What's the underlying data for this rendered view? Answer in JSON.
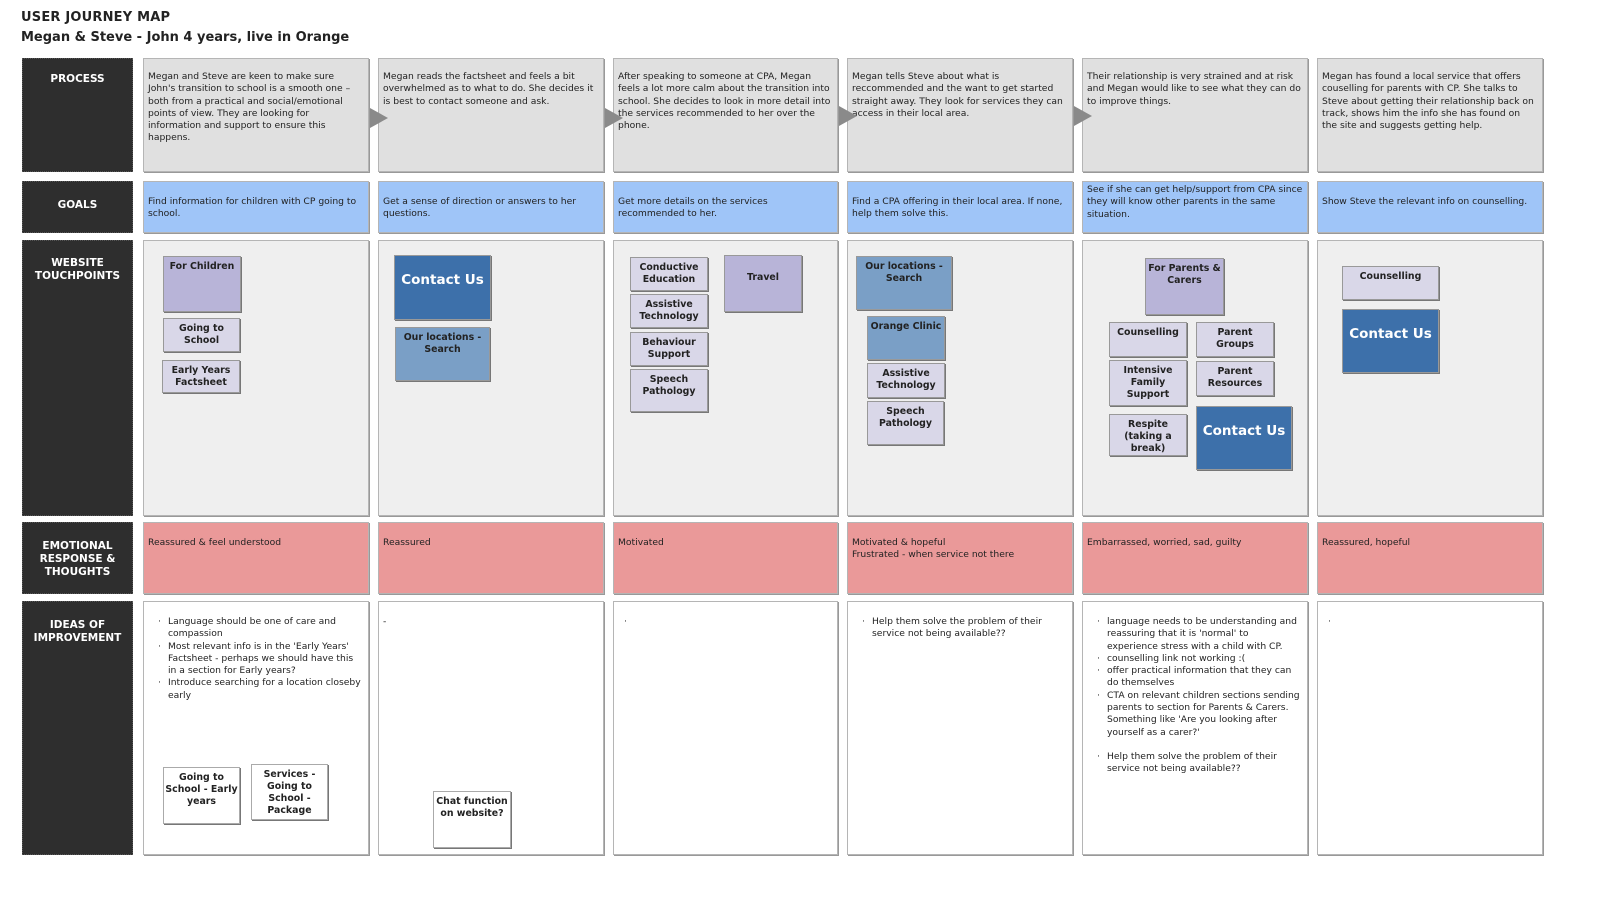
{
  "header": {
    "title": "USER JOURNEY MAP",
    "subtitle": "Megan & Steve - John 4 years, live in Orange"
  },
  "row_labels": {
    "process": "PROCESS",
    "goals": "GOALS",
    "touchpoints": "WEBSITE TOUCHPOINTS",
    "emotional": "EMOTIONAL RESPONSE & THOUGHTS",
    "ideas": "IDEAS OF IMPROVEMENT"
  },
  "colors": {
    "label_bg": "#2e2e2e",
    "process_bg": "#e0e0e0",
    "goal_bg": "#9fc5f8",
    "emotion_bg": "#ea9999",
    "touch_bg": "#efefef",
    "contact_bg": "#3d70aa",
    "location_bg": "#7a9fc6",
    "page_bg": "#d9d7e8",
    "section_bg": "#b8b4d8"
  },
  "stages": [
    {
      "process": "Megan and Steve are keen to make sure John's transition to school is a smooth one – both from a practical and social/emotional points of view. They are looking for information and support to ensure this happens.",
      "goal": "Find information for children with CP going to school.",
      "emotion": "Reassured & feel understood",
      "ideas": [
        "Language should be one of care and compassion",
        "Most relevant info is in the 'Early Years' Factsheet - perhaps we should have this in a section for Early years?",
        "Introduce searching for a location closeby early"
      ],
      "touchpoints": [
        "For Children",
        "Going to School",
        "Early Years Factsheet"
      ],
      "idea_boxes": [
        "Going to School - Early years",
        "Services - Going to School - Package"
      ]
    },
    {
      "process": "Megan reads the factsheet and feels a bit overwhelmed as to what to do. She decides it is best to contact someone and ask.",
      "goal": "Get a sense of direction or answers to her questions.",
      "emotion": "Reassured",
      "ideas_text": "-",
      "touchpoints": [
        "Contact Us",
        "Our locations - Search"
      ],
      "idea_boxes": [
        "Chat function on website?"
      ]
    },
    {
      "process": "After speaking to someone at CPA, Megan feels a lot more calm about the transition into school. She decides to look in more detail into the services recommended to her over the phone.",
      "goal": "Get more details on the services recommended to her.",
      "emotion": "Motivated",
      "ideas_text": "·",
      "touchpoints": [
        "Conductive Education",
        "Assistive Technology",
        "Behaviour Support",
        "Speech Pathology",
        "Travel"
      ]
    },
    {
      "process": "Megan tells Steve about what is reccommended and the want to get started straight away. They look for services they can access in their local area.",
      "goal": "Find a CPA offering in their local area. If none, help them solve this.",
      "emotion_lines": [
        "Motivated & hopeful",
        "Frustrated - when service not there"
      ],
      "ideas": [
        "Help them solve the problem of their service not being available??"
      ],
      "touchpoints": [
        "Our locations - Search",
        "Orange Clinic",
        "Assistive Technology",
        "Speech Pathology"
      ]
    },
    {
      "process": "Their relationship is very strained and at risk and Megan would like to see what they can do to improve things.",
      "goal": "See if she can get help/support from CPA since they will know other parents in the same situation.",
      "emotion": "Embarrassed, worried, sad, guilty",
      "ideas": [
        "language needs to be understanding and reassuring that it is 'normal' to experience stress with a child with CP.",
        "counselling link not working :(",
        "offer practical information that they can do themselves",
        "CTA on relevant children sections sending parents to section for Parents & Carers. Something like 'Are you looking after yourself as a carer?'",
        "Help them solve the problem of their service not being available??"
      ],
      "touchpoints": [
        "For Parents & Carers",
        "Counselling",
        "Parent Groups",
        "Intensive Family Support",
        "Parent Resources",
        "Respite (taking a break)",
        "Contact Us"
      ]
    },
    {
      "process": "Megan has found a local service that offers couselling for parents with CP. She talks to Steve about getting their relationship back on track, shows him the info she has found on the site and suggests getting help.",
      "goal": "Show Steve the relevant info on counselling.",
      "emotion": "Reassured, hopeful",
      "ideas_text": "·",
      "touchpoints": [
        "Counselling",
        "Contact Us"
      ]
    }
  ]
}
